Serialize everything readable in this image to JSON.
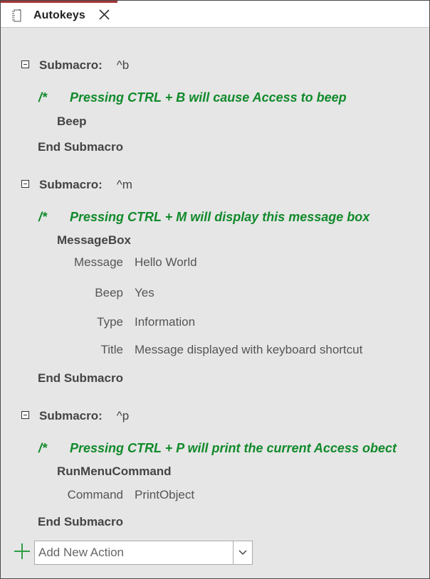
{
  "tab": {
    "title": "Autokeys"
  },
  "keywords": {
    "submacro": "Submacro:",
    "end_submacro": "End Submacro",
    "comment_mark": "/*"
  },
  "submacros": [
    {
      "name": "^b",
      "comment": "Pressing CTRL + B will cause Access to beep",
      "action": "Beep",
      "arguments": []
    },
    {
      "name": "^m",
      "comment": "Pressing CTRL + M will display this message box",
      "action": "MessageBox",
      "arguments": [
        {
          "label": "Message",
          "value": "Hello World"
        },
        {
          "label": "Beep",
          "value": "Yes"
        },
        {
          "label": "Type",
          "value": "Information"
        },
        {
          "label": "Title",
          "value": "Message displayed with keyboard shortcut"
        }
      ]
    },
    {
      "name": "^p",
      "comment": "Pressing CTRL + P will print the current Access obect",
      "action": "RunMenuCommand",
      "arguments": [
        {
          "label": "Command",
          "value": "PrintObject"
        }
      ]
    }
  ],
  "add_action": {
    "placeholder": "Add New Action"
  },
  "colors": {
    "comment": "#118a2b",
    "tab_accent": "#a4373a",
    "text": "#444444"
  }
}
